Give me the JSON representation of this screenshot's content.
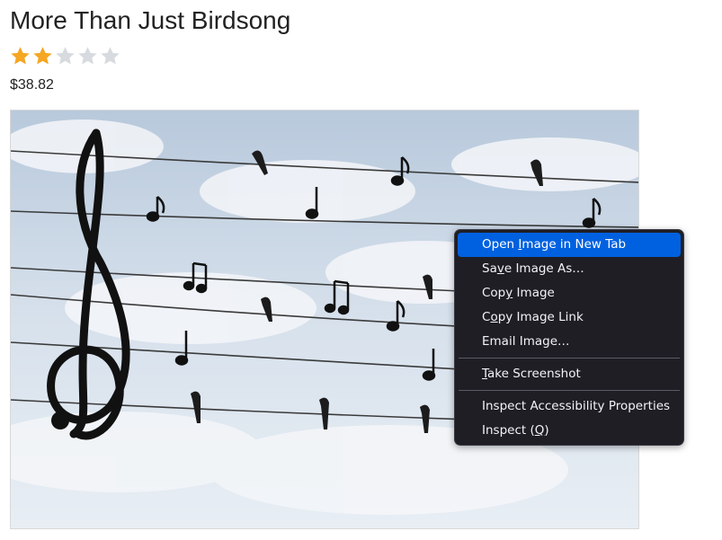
{
  "product": {
    "title": "More Than Just Birdsong",
    "rating": 2,
    "rating_max": 5,
    "price": "$38.82"
  },
  "colors": {
    "star_filled": "#f5a623",
    "star_empty": "#d7dade",
    "menu_bg": "#1f1e25",
    "menu_highlight": "#0061e0"
  },
  "image": {
    "icon": "photo-birds-on-wires-music-notes"
  },
  "context_menu": {
    "items": [
      {
        "pre": "Open ",
        "key": "I",
        "post": "mage in New Tab"
      },
      {
        "pre": "Sa",
        "key": "v",
        "post": "e Image As…"
      },
      {
        "pre": "Cop",
        "key": "y",
        "post": " Image"
      },
      {
        "pre": "C",
        "key": "o",
        "post": "py Image Link"
      },
      {
        "pre": "Email Image…",
        "key": "",
        "post": ""
      },
      {
        "pre": "",
        "key": "T",
        "post": "ake Screenshot"
      },
      {
        "pre": "Inspect Accessibility Properties",
        "key": "",
        "post": ""
      },
      {
        "pre": "Inspect (",
        "key": "Q",
        "post": ")"
      }
    ]
  }
}
